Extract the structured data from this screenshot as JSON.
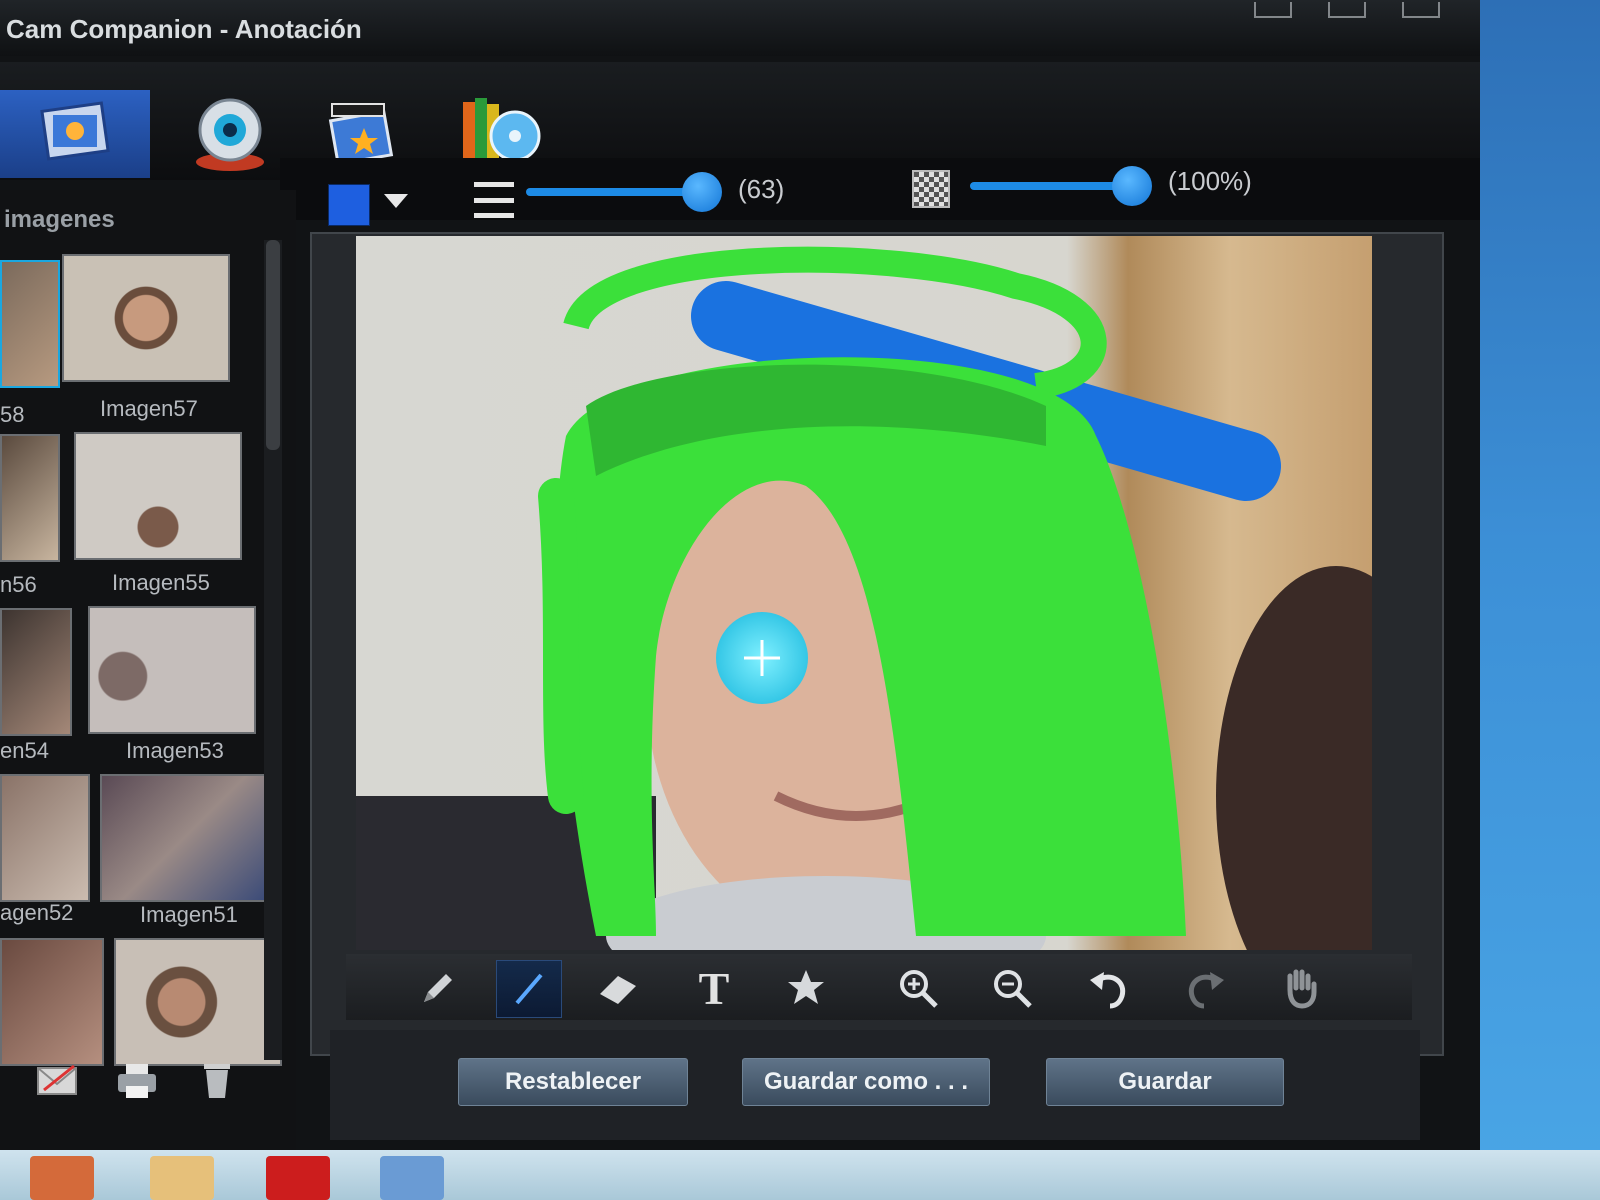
{
  "window": {
    "title": "Cam Companion  - Anotación"
  },
  "toolbar": {
    "brush_size_label": "(63)",
    "brush_size_value": 63,
    "opacity_label": "(100%)",
    "opacity_value": 100,
    "color": "#1e5fe0"
  },
  "gallery": {
    "title": "imagenes",
    "items": [
      {
        "label": "58",
        "selected": true
      },
      {
        "label": "Imagen57"
      },
      {
        "label": "n56"
      },
      {
        "label": "Imagen55"
      },
      {
        "label": "en54"
      },
      {
        "label": "Imagen53"
      },
      {
        "label": "agen52"
      },
      {
        "label": "Imagen51"
      }
    ]
  },
  "tools": {
    "text_tool_glyph": "T"
  },
  "actions": {
    "reset": "Restablecer",
    "save_as": "Guardar como . . .",
    "save": "Guardar"
  },
  "icons": {
    "mode_tabs": [
      "annotation-icon",
      "webcam-icon",
      "video-effects-icon",
      "library-icon"
    ],
    "tools": [
      "pencil-icon",
      "line-icon",
      "eraser-icon",
      "text-icon",
      "stamp-icon",
      "zoom-in-icon",
      "zoom-out-icon",
      "undo-icon",
      "redo-icon",
      "hand-icon"
    ],
    "bottom": [
      "email-icon",
      "print-icon",
      "trash-icon"
    ]
  },
  "colors": {
    "accent": "#1d8be6",
    "annotation_green": "#3be03a",
    "annotation_blue": "#1a72e0"
  }
}
